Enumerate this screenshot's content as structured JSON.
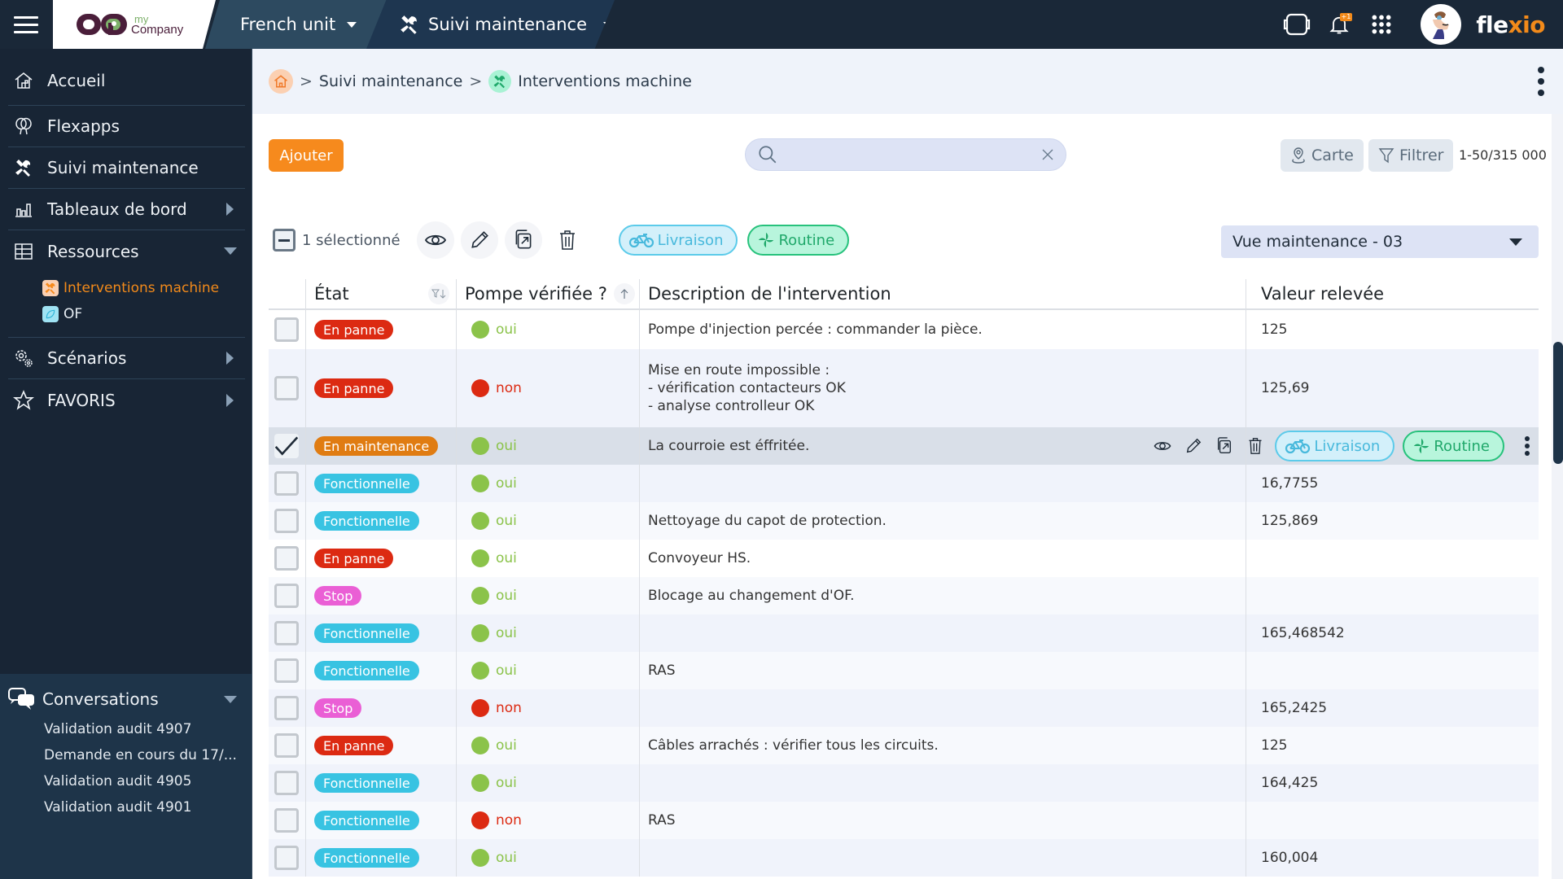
{
  "topbar": {
    "logo_my": "my",
    "logo_company": "Company",
    "unit_label": "French unit",
    "app_label": "Suivi maintenance",
    "notification_badge": "+1",
    "brand_prefix": "fle",
    "brand_x": "x",
    "brand_suffix": "io",
    "icons": [
      "tablet-icon",
      "bell-icon",
      "apps-grid-icon",
      "user-avatar"
    ]
  },
  "sidebar": {
    "items": [
      {
        "label": "Accueil",
        "icon": "home-icon"
      },
      {
        "label": "Flexapps",
        "icon": "balloons-icon"
      },
      {
        "label": "Suivi maintenance",
        "icon": "tools-icon"
      },
      {
        "label": "Tableaux de bord",
        "icon": "bar-chart-icon",
        "expand": "collapsed"
      },
      {
        "label": "Ressources",
        "icon": "table-icon",
        "expand": "expanded"
      },
      {
        "label": "Scénarios",
        "icon": "gears-icon",
        "expand": "collapsed"
      },
      {
        "label": "FAVORIS",
        "icon": "star-icon",
        "expand": "collapsed"
      }
    ],
    "resources": [
      {
        "label": "Interventions machine",
        "active": true,
        "icon": "tools-icon"
      },
      {
        "label": "OF",
        "active": false,
        "icon": "leaf-icon"
      }
    ],
    "conversations": {
      "title": "Conversations",
      "items": [
        "Validation audit 4907",
        "Demande en cours du 17/...",
        "Validation audit 4905",
        "Validation audit 4901"
      ]
    }
  },
  "breadcrumb": {
    "items": [
      "Suivi maintenance",
      "Interventions machine"
    ]
  },
  "toolbar": {
    "add_label": "Ajouter",
    "search_placeholder": "",
    "search_value": "",
    "map_label": "Carte",
    "filter_label": "Filtrer",
    "count": "1-50/315 000"
  },
  "selection": {
    "text": "1 sélectionné",
    "tags": [
      "Livraison",
      "Routine"
    ]
  },
  "view": {
    "selected": "Vue maintenance - 03"
  },
  "table": {
    "columns": [
      "État",
      "Pompe vérifiée ?",
      "Description de l'intervention",
      "Valeur relevée"
    ],
    "rows": [
      {
        "etat": "En panne",
        "pompe": "oui",
        "desc": "Pompe d'injection percée : commander la pièce.",
        "val": "125",
        "checked": false
      },
      {
        "etat": "En panne",
        "pompe": "non",
        "desc": "Mise en route impossible :\n- vérification contacteurs OK\n- analyse controlleur OK",
        "val": "125,69",
        "checked": false
      },
      {
        "etat": "En maintenance",
        "pompe": "oui",
        "desc": "La courroie est éffritée.",
        "val": "",
        "checked": true
      },
      {
        "etat": "Fonctionnelle",
        "pompe": "oui",
        "desc": "",
        "val": "16,7755",
        "checked": false
      },
      {
        "etat": "Fonctionnelle",
        "pompe": "oui",
        "desc": "Nettoyage du capot de protection.",
        "val": "125,869",
        "checked": false
      },
      {
        "etat": "En panne",
        "pompe": "oui",
        "desc": "Convoyeur HS.",
        "val": "",
        "checked": false
      },
      {
        "etat": "Stop",
        "pompe": "oui",
        "desc": "Blocage au changement d'OF.",
        "val": "",
        "checked": false
      },
      {
        "etat": "Fonctionnelle",
        "pompe": "oui",
        "desc": "",
        "val": "165,468542",
        "checked": false
      },
      {
        "etat": "Fonctionnelle",
        "pompe": "oui",
        "desc": "RAS",
        "val": "",
        "checked": false
      },
      {
        "etat": "Stop",
        "pompe": "non",
        "desc": "",
        "val": "165,2425",
        "checked": false
      },
      {
        "etat": "En panne",
        "pompe": "oui",
        "desc": "Câbles arrachés : vérifier tous les circuits.",
        "val": "125",
        "checked": false
      },
      {
        "etat": "Fonctionnelle",
        "pompe": "oui",
        "desc": "",
        "val": "164,425",
        "checked": false
      },
      {
        "etat": "Fonctionnelle",
        "pompe": "non",
        "desc": "RAS",
        "val": "",
        "checked": false
      },
      {
        "etat": "Fonctionnelle",
        "pompe": "oui",
        "desc": "",
        "val": "160,004",
        "checked": false
      }
    ],
    "row_action_tags": [
      "Livraison",
      "Routine"
    ]
  },
  "colors": {
    "topbar": "#1a2838",
    "sidebar": "#182535",
    "accent": "#f68a1d",
    "etat": {
      "En panne": "#dc2a12",
      "En maintenance": "#e07c12",
      "Fonctionnelle": "#38c3e2",
      "Stop": "#ea5fd5"
    },
    "pompe": {
      "oui": "#8bc34a",
      "non": "#dc2a12"
    }
  }
}
